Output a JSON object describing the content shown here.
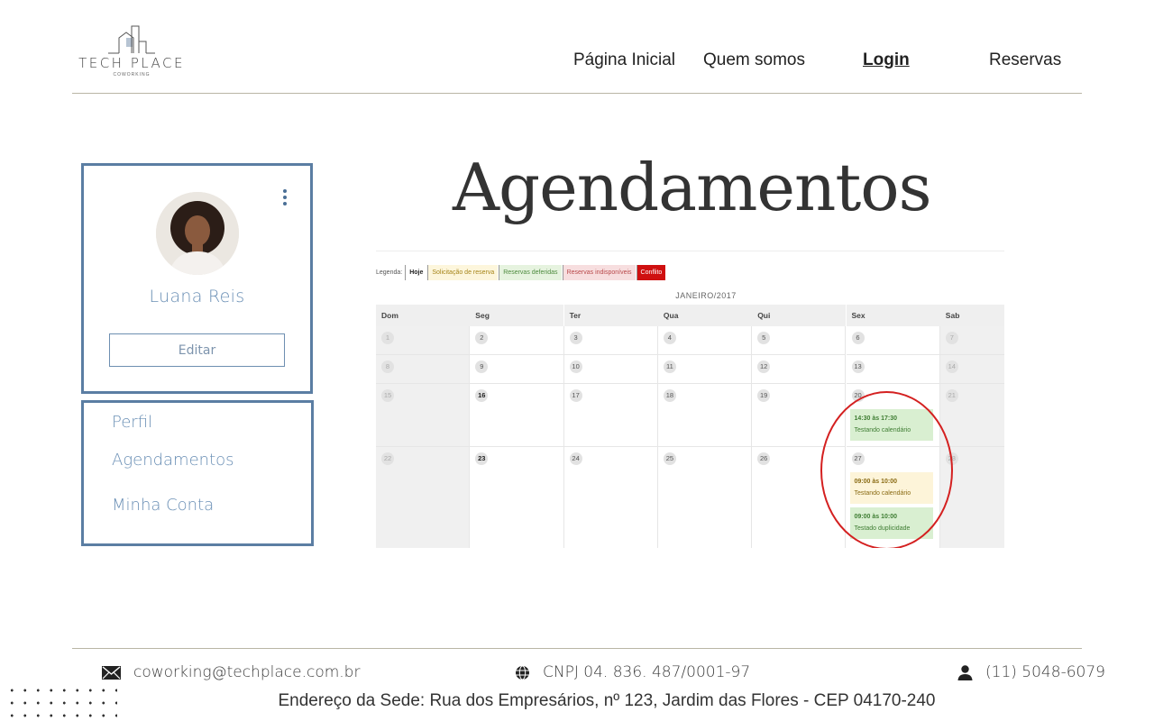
{
  "header": {
    "brand": "TECH PLACE",
    "brand_sub": "COWORKING",
    "nav": [
      "Página Inicial",
      "Quem somos",
      "Login ",
      "Reservas"
    ]
  },
  "profile": {
    "name": "Luana Reis",
    "edit_label": "Editar",
    "menu": [
      "Perfil",
      "Agendamentos",
      "Minha Conta"
    ]
  },
  "page_title": "Agendamentos",
  "calendar": {
    "legend_label": "Legenda:",
    "legend": [
      "Hoje",
      "Solicitação de reserva",
      "Reservas deferidas",
      "Reservas indisponíveis",
      "Conflito"
    ],
    "month": "JANEIRO/2017",
    "weekdays": [
      "Dom",
      "Seg",
      "Ter",
      "Qua",
      "Qui",
      "Sex",
      "Sab"
    ],
    "weeks": [
      [
        "1",
        "2",
        "3",
        "4",
        "5",
        "6",
        "7"
      ],
      [
        "8",
        "9",
        "10",
        "11",
        "12",
        "13",
        "14"
      ],
      [
        "15",
        "16",
        "17",
        "18",
        "19",
        "20",
        "21"
      ],
      [
        "22",
        "23",
        "24",
        "25",
        "26",
        "27",
        "28"
      ]
    ],
    "events": [
      {
        "day": "20",
        "time": "14:30 às 17:30",
        "title": "Testando calendário",
        "status": "green"
      },
      {
        "day": "27",
        "time": "09:00 às 10:00",
        "title": "Testando calendário",
        "status": "yellow"
      },
      {
        "day": "27",
        "time": "09:00 às 10:00",
        "title": "Testado duplicidade",
        "status": "green"
      }
    ],
    "colors": {
      "conflict": "#cf1010",
      "approved": "#d9efd1",
      "pending": "#fdf4d9"
    }
  },
  "footer": {
    "email": "coworking@techplace.com.br",
    "cnpj": "CNPJ 04. 836. 487/0001-97",
    "phone": "(11) 5048-6079",
    "address": "Endereço da Sede: Rua dos Empresários, nº 123, Jardim das Flores - CEP 04170-240"
  }
}
